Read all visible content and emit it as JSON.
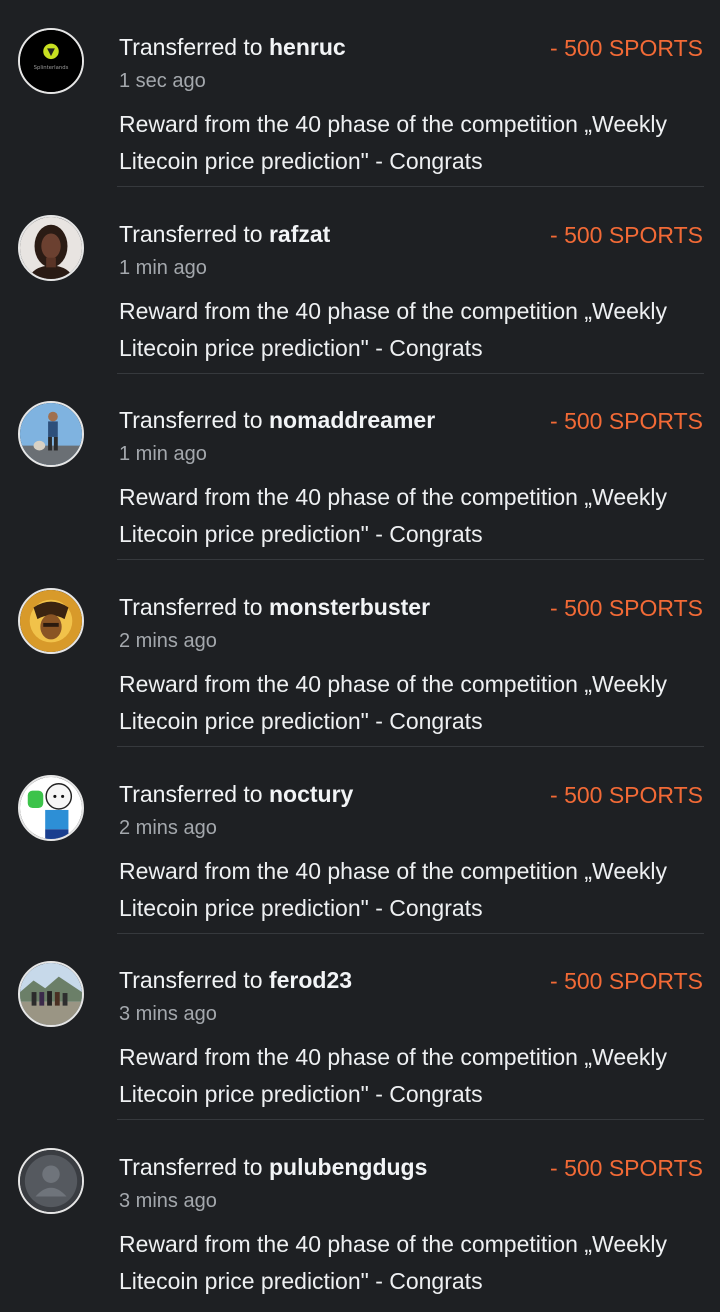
{
  "transfers": [
    {
      "prefix": "Transferred to ",
      "username": "henruc",
      "amount": "- 500 SPORTS",
      "time": "1 sec ago",
      "memo": "Reward from the 40 phase of the competition „Weekly Litecoin price prediction\" - Congrats",
      "avatar": "logo-avatar",
      "avatar_logo_text": "Splinterlands"
    },
    {
      "prefix": "Transferred to ",
      "username": "rafzat",
      "amount": "- 500 SPORTS",
      "time": "1 min ago",
      "memo": "Reward from the 40 phase of the competition „Weekly Litecoin price prediction\" - Congrats",
      "avatar": "portrait-avatar"
    },
    {
      "prefix": "Transferred to ",
      "username": "nomaddreamer",
      "amount": "- 500 SPORTS",
      "time": "1 min ago",
      "memo": "Reward from the 40 phase of the competition „Weekly Litecoin price prediction\" - Congrats",
      "avatar": "hiker-avatar"
    },
    {
      "prefix": "Transferred to ",
      "username": "monsterbuster",
      "amount": "- 500 SPORTS",
      "time": "2 mins ago",
      "memo": "Reward from the 40 phase of the competition „Weekly Litecoin price prediction\" - Congrats",
      "avatar": "art-avatar"
    },
    {
      "prefix": "Transferred to ",
      "username": "noctury",
      "amount": "- 500 SPORTS",
      "time": "2 mins ago",
      "memo": "Reward from the 40 phase of the competition „Weekly Litecoin price prediction\" - Congrats",
      "avatar": "cartoon-avatar"
    },
    {
      "prefix": "Transferred to ",
      "username": "ferod23",
      "amount": "- 500 SPORTS",
      "time": "3 mins ago",
      "memo": "Reward from the 40 phase of the competition „Weekly Litecoin price prediction\" - Congrats",
      "avatar": "group-photo-avatar"
    },
    {
      "prefix": "Transferred to ",
      "username": "pulubengdugs",
      "amount": "- 500 SPORTS",
      "time": "3 mins ago",
      "memo": "Reward from the 40 phase of the competition „Weekly Litecoin price prediction\" - Congrats",
      "avatar": "default-user-avatar"
    }
  ],
  "colors": {
    "background": "#1e2023",
    "amount": "#f26a36",
    "timestamp": "#a4a8ad",
    "divider": "#36393d"
  }
}
